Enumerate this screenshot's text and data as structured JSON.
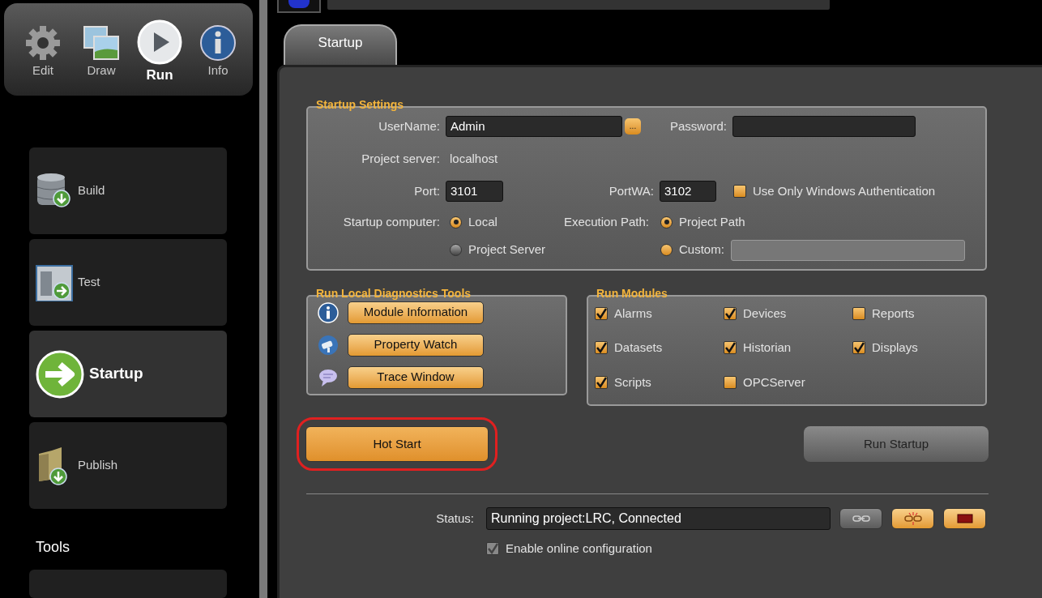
{
  "modes": [
    {
      "label": "Edit",
      "kind": "gear",
      "selected": false
    },
    {
      "label": "Draw",
      "kind": "pictures",
      "selected": false
    },
    {
      "label": "Run",
      "kind": "play",
      "selected": true
    },
    {
      "label": "Info",
      "kind": "info",
      "selected": false
    }
  ],
  "sidebar": {
    "items": [
      {
        "label": "Build",
        "kind": "database",
        "selected": false
      },
      {
        "label": "Test",
        "kind": "window",
        "selected": false
      },
      {
        "label": "Startup",
        "kind": "arrow",
        "selected": true
      },
      {
        "label": "Publish",
        "kind": "folder",
        "selected": false
      }
    ],
    "tools_heading": "Tools"
  },
  "tabs": [
    {
      "label": "Startup",
      "selected": true
    }
  ],
  "startup_settings": {
    "title": "Startup Settings",
    "username": {
      "label": "UserName:",
      "value": "Admin",
      "browse": "..."
    },
    "password": {
      "label": "Password:"
    },
    "project_server": {
      "label": "Project server:",
      "value": "localhost"
    },
    "port": {
      "label": "Port:",
      "value": "3101"
    },
    "port_wa": {
      "label": "PortWA:",
      "value": "3102"
    },
    "windows_auth": {
      "label": "Use Only Windows Authentication",
      "checked": false
    },
    "startup_computer": {
      "label": "Startup computer:",
      "options": [
        {
          "label": "Local",
          "selected": true,
          "disabled": false
        },
        {
          "label": "Project Server",
          "selected": false,
          "disabled": true
        }
      ]
    },
    "execution_path": {
      "label": "Execution Path:",
      "options": [
        {
          "label": "Project Path",
          "selected": true,
          "disabled": false
        },
        {
          "label": "Custom:",
          "selected": false,
          "disabled": false
        }
      ]
    }
  },
  "diagnostics": {
    "title": "Run Local Diagnostics Tools",
    "tools": [
      {
        "label": "Module Information",
        "kind": "info"
      },
      {
        "label": "Property Watch",
        "kind": "camera"
      },
      {
        "label": "Trace Window",
        "kind": "speech"
      }
    ]
  },
  "modules": {
    "title": "Run Modules",
    "items": [
      {
        "label": "Alarms",
        "checked": true
      },
      {
        "label": "Devices",
        "checked": true
      },
      {
        "label": "Reports",
        "checked": false
      },
      {
        "label": "Datasets",
        "checked": true
      },
      {
        "label": "Historian",
        "checked": true
      },
      {
        "label": "Displays",
        "checked": true
      },
      {
        "label": "Scripts",
        "checked": true
      },
      {
        "label": "OPCServer",
        "checked": false
      }
    ]
  },
  "hot_start": {
    "label": "Hot Start",
    "highlighted": true
  },
  "run_startup": {
    "label": "Run Startup",
    "disabled": true
  },
  "status": {
    "label": "Status:",
    "value": "Running project:LRC, Connected",
    "buttons": [
      {
        "kind": "link",
        "disabled": true
      },
      {
        "kind": "unlink",
        "disabled": false
      },
      {
        "kind": "stop",
        "disabled": false
      }
    ]
  },
  "online_config": {
    "label": "Enable online configuration",
    "checked": true,
    "disabled": true
  }
}
